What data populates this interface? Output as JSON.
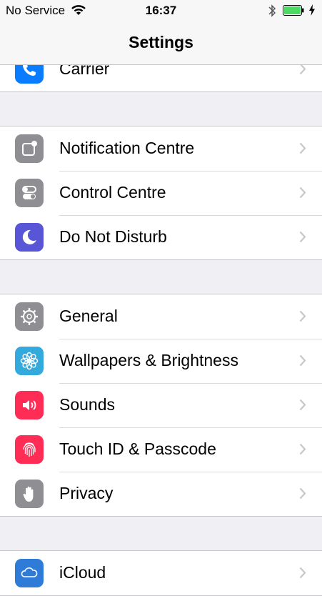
{
  "status_bar": {
    "carrier": "No Service",
    "time": "16:37"
  },
  "nav": {
    "title": "Settings"
  },
  "groups": [
    {
      "items": [
        {
          "label": "Carrier",
          "icon": "phone-icon",
          "color": "#0a7cff"
        }
      ]
    },
    {
      "items": [
        {
          "label": "Notification Centre",
          "icon": "notification-centre-icon",
          "color": "#8e8e93"
        },
        {
          "label": "Control Centre",
          "icon": "control-centre-icon",
          "color": "#8e8e93"
        },
        {
          "label": "Do Not Disturb",
          "icon": "moon-icon",
          "color": "#5856d6"
        }
      ]
    },
    {
      "items": [
        {
          "label": "General",
          "icon": "gear-icon",
          "color": "#8e8e93"
        },
        {
          "label": "Wallpapers & Brightness",
          "icon": "flower-icon",
          "color": "#34aadc"
        },
        {
          "label": "Sounds",
          "icon": "speaker-icon",
          "color": "#ff2d55"
        },
        {
          "label": "Touch ID & Passcode",
          "icon": "fingerprint-icon",
          "color": "#ff2d55"
        },
        {
          "label": "Privacy",
          "icon": "hand-icon",
          "color": "#8e8e93"
        }
      ]
    },
    {
      "items": [
        {
          "label": "iCloud",
          "icon": "cloud-icon",
          "color": "#2f7bd8"
        }
      ]
    }
  ],
  "colors": {
    "battery_fill": "#4cd964",
    "chevron": "#c7c7cc",
    "background": "#efeff4"
  }
}
